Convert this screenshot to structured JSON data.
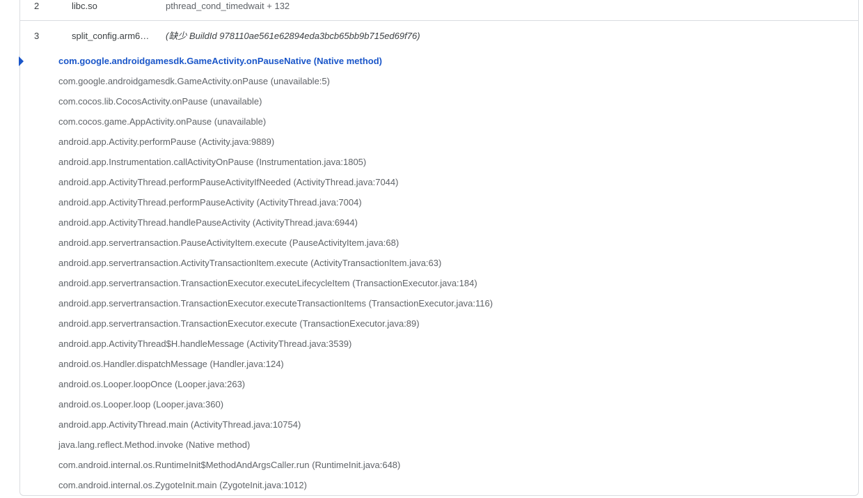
{
  "frames": [
    {
      "index": "2",
      "library": "libc.so",
      "symbol": "pthread_cond_timedwait + 132"
    },
    {
      "index": "3",
      "library": "split_config.arm6…",
      "symbol": "(缺少 BuildId 978110ae561e62894eda3bcb65bb9b715ed69f76)"
    }
  ],
  "stack_trace": [
    "com.google.androidgamesdk.GameActivity.onPauseNative (Native method)",
    "com.google.androidgamesdk.GameActivity.onPause (unavailable:5)",
    "com.cocos.lib.CocosActivity.onPause (unavailable)",
    "com.cocos.game.AppActivity.onPause (unavailable)",
    "android.app.Activity.performPause (Activity.java:9889)",
    "android.app.Instrumentation.callActivityOnPause (Instrumentation.java:1805)",
    "android.app.ActivityThread.performPauseActivityIfNeeded (ActivityThread.java:7044)",
    "android.app.ActivityThread.performPauseActivity (ActivityThread.java:7004)",
    "android.app.ActivityThread.handlePauseActivity (ActivityThread.java:6944)",
    "android.app.servertransaction.PauseActivityItem.execute (PauseActivityItem.java:68)",
    "android.app.servertransaction.ActivityTransactionItem.execute (ActivityTransactionItem.java:63)",
    "android.app.servertransaction.TransactionExecutor.executeLifecycleItem (TransactionExecutor.java:184)",
    "android.app.servertransaction.TransactionExecutor.executeTransactionItems (TransactionExecutor.java:116)",
    "android.app.servertransaction.TransactionExecutor.execute (TransactionExecutor.java:89)",
    "android.app.ActivityThread$H.handleMessage (ActivityThread.java:3539)",
    "android.os.Handler.dispatchMessage (Handler.java:124)",
    "android.os.Looper.loopOnce (Looper.java:263)",
    "android.os.Looper.loop (Looper.java:360)",
    "android.app.ActivityThread.main (ActivityThread.java:10754)",
    "java.lang.reflect.Method.invoke (Native method)",
    "com.android.internal.os.RuntimeInit$MethodAndArgsCaller.run (RuntimeInit.java:648)",
    "com.android.internal.os.ZygoteInit.main (ZygoteInit.java:1012)"
  ],
  "active_index": 0,
  "colors": {
    "accent": "#1a56c9",
    "text": "#5f6368",
    "border": "#dadce0"
  },
  "icons": {
    "active_marker": "caret-right-icon"
  }
}
